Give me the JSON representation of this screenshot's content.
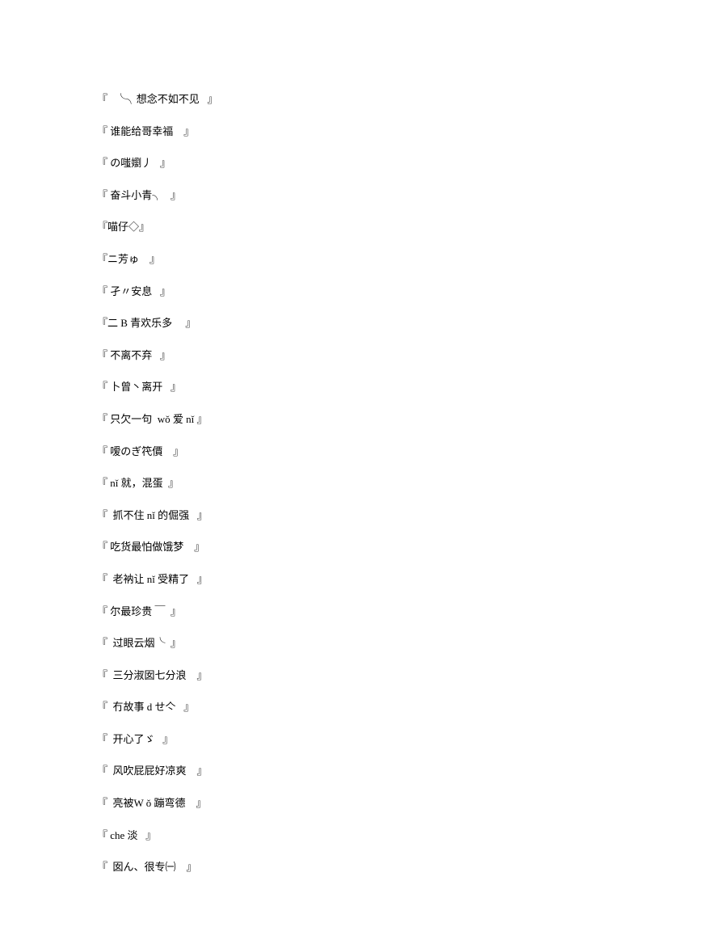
{
  "lines": [
    "『   ╰╮想念不如不见   』",
    "『 谁能给哥幸福    』",
    "『 の嗤嬼丿   』",
    "『 奋斗小青╮   』",
    "『喵仔◇』",
    "『ニ芳ゅ    』",
    "『 孑〃安息   』",
    "『二 B 青欢乐多     』",
    "『 不离不弃   』",
    "『 卜曾丶离开   』",
    "『 只欠一句  wǒ 爱 nǐ 』",
    "『 嗳のぎ笩價    』",
    "『 nǐ 就，混蛋  』",
    "『  抓不住 nǐ 的倔强   』",
    "『 吃货最怕做饿梦    』",
    "『  老衲让 nǐ 受精了   』",
    "『 尔最珍贵 ￣  』",
    "『  过眼云烟╰  』",
    "『  三分淑囡七分浪    』",
    "『  冇故事 d せ亽   』",
    "『  开心了ゞ   』",
    "『  风吹屁屁好凉爽    』",
    "『  亮被W ǒ 蹦弯德    』",
    "『 che 淡   』",
    "『  囡ん、很专㈠    』"
  ]
}
